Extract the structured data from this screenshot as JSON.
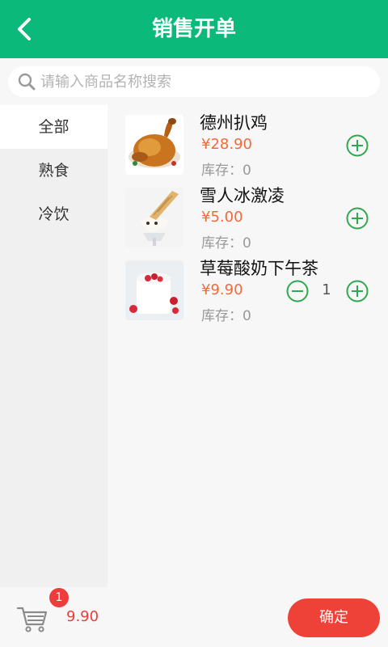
{
  "header": {
    "title": "销售开单",
    "back_icon": "chevron-left-icon"
  },
  "search": {
    "placeholder": "请输入商品名称搜索",
    "value": ""
  },
  "sidebar": {
    "categories": [
      {
        "label": "全部",
        "active": true
      },
      {
        "label": "熟食",
        "active": false
      },
      {
        "label": "冷饮",
        "active": false
      }
    ]
  },
  "products": [
    {
      "name": "德州扒鸡",
      "price": "¥28.90",
      "stock": "库存：0",
      "quantity": null,
      "image": "roast-chicken"
    },
    {
      "name": "雪人冰激凌",
      "price": "¥5.00",
      "stock": "库存：0",
      "quantity": null,
      "image": "ice-cream-cone"
    },
    {
      "name": "草莓酸奶下午茶",
      "price": "¥9.90",
      "stock": "库存：0",
      "quantity": "1",
      "image": "strawberry-yogurt"
    }
  ],
  "cart": {
    "count": "1",
    "total": "9.90",
    "confirm_label": "确定"
  },
  "colors": {
    "header": "#0bb97a",
    "accent_green": "#2fa84f",
    "price": "#f06a3a",
    "badge": "#ee3b3b",
    "confirm": "#ee4238"
  }
}
